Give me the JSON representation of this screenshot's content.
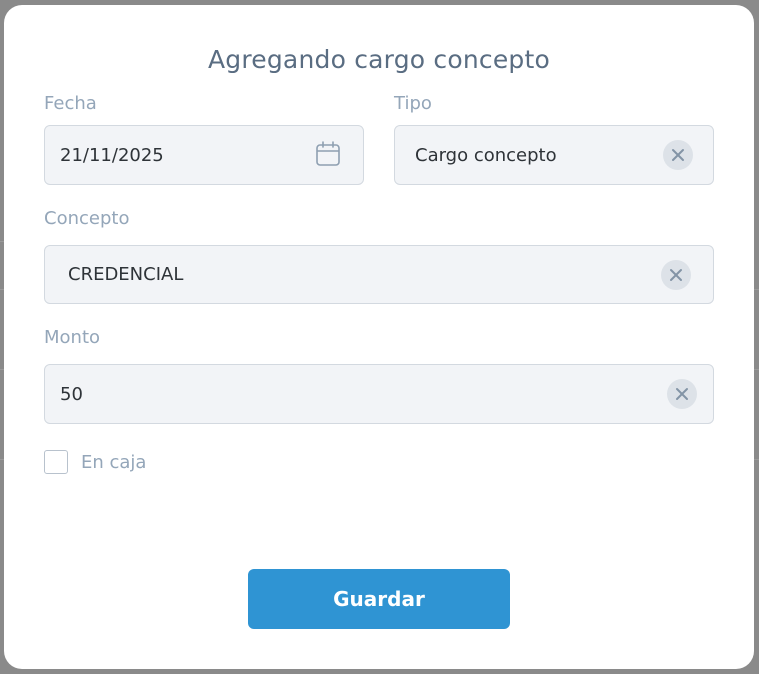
{
  "modal": {
    "title": "Agregando cargo concepto"
  },
  "fields": {
    "fecha": {
      "label": "Fecha",
      "value": "21/11/2025"
    },
    "tipo": {
      "label": "Tipo",
      "value": "Cargo concepto"
    },
    "concepto": {
      "label": "Concepto",
      "value": "CREDENCIAL"
    },
    "monto": {
      "label": "Monto",
      "value": "50"
    }
  },
  "en_caja": {
    "label": "En caja",
    "checked": false
  },
  "actions": {
    "save_label": "Guardar"
  },
  "icons": {
    "date": "calendar-icon",
    "clear": "close-icon"
  },
  "colors": {
    "primary_button": "#2f94d3",
    "overlay": "#8a8a8a"
  }
}
